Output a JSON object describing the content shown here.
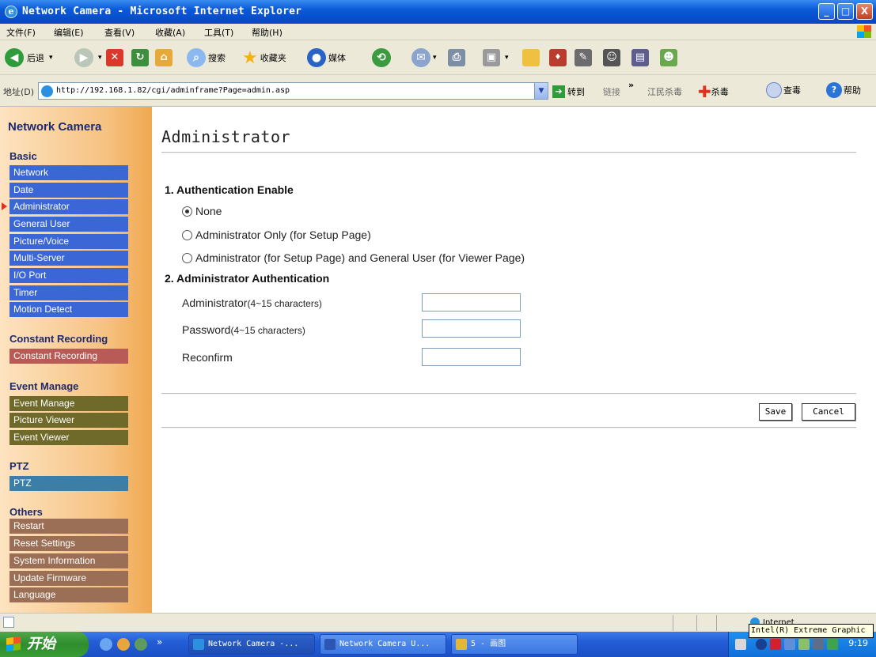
{
  "window": {
    "title": "Network Camera - Microsoft Internet Explorer",
    "controls": [
      "_",
      "□",
      "X"
    ]
  },
  "menu": [
    "文件(F)",
    "编辑(E)",
    "查看(V)",
    "收藏(A)",
    "工具(T)",
    "帮助(H)"
  ],
  "toolbar": {
    "back": "后退",
    "search": "搜索",
    "favorites": "收藏夹",
    "media": "媒体"
  },
  "addressbar": {
    "label": "地址(D)",
    "url": "http://192.168.1.82/cgi/adminframe?Page=admin.asp",
    "go": "转到",
    "links": "链接",
    "links_more": "»",
    "jm_kill": "江民杀毒",
    "kill": "杀毒",
    "scan": "查毒",
    "help": "帮助"
  },
  "sidebar": {
    "title": "Network Camera",
    "sections": [
      {
        "name": "Basic",
        "items": [
          "Network",
          "Date",
          "Administrator",
          "General User",
          "Picture/Voice",
          "Multi-Server",
          "I/O Port",
          "Timer",
          "Motion Detect"
        ]
      },
      {
        "name": "Constant Recording",
        "items": [
          "Constant Recording"
        ]
      },
      {
        "name": "Event Manage",
        "items": [
          "Event Manage",
          "Picture Viewer",
          "Event Viewer"
        ]
      },
      {
        "name": "PTZ",
        "items": [
          "PTZ"
        ]
      },
      {
        "name": "Others",
        "items": [
          "Restart",
          "Reset Settings",
          "System Information",
          "Update Firmware",
          "Language"
        ]
      }
    ],
    "selected": "Administrator"
  },
  "main": {
    "page_title": "Administrator",
    "auth_enable": {
      "heading": "1. Authentication Enable",
      "options": [
        "None",
        "Administrator Only (for Setup Page)",
        "Administrator (for Setup Page) and General User (for Viewer Page)"
      ],
      "selected": "None"
    },
    "admin_auth": {
      "heading": "2. Administrator Authentication",
      "fields": [
        {
          "label": "Administrator",
          "hint": "(4~15 characters)",
          "value": ""
        },
        {
          "label": "Password",
          "hint": "(4~15 characters)",
          "value": ""
        },
        {
          "label": "Reconfirm",
          "hint": "",
          "value": ""
        }
      ]
    },
    "save_label": "Save",
    "cancel_label": "Cancel"
  },
  "statusbar": {
    "zone": "Internet",
    "tooltip": "Intel(R) Extreme Graphic"
  },
  "taskbar": {
    "start": "开始",
    "more": "»",
    "tasks": [
      "Network Camera -...",
      "Network Camera U...",
      "5 - 画图"
    ],
    "clock": "9:19"
  }
}
